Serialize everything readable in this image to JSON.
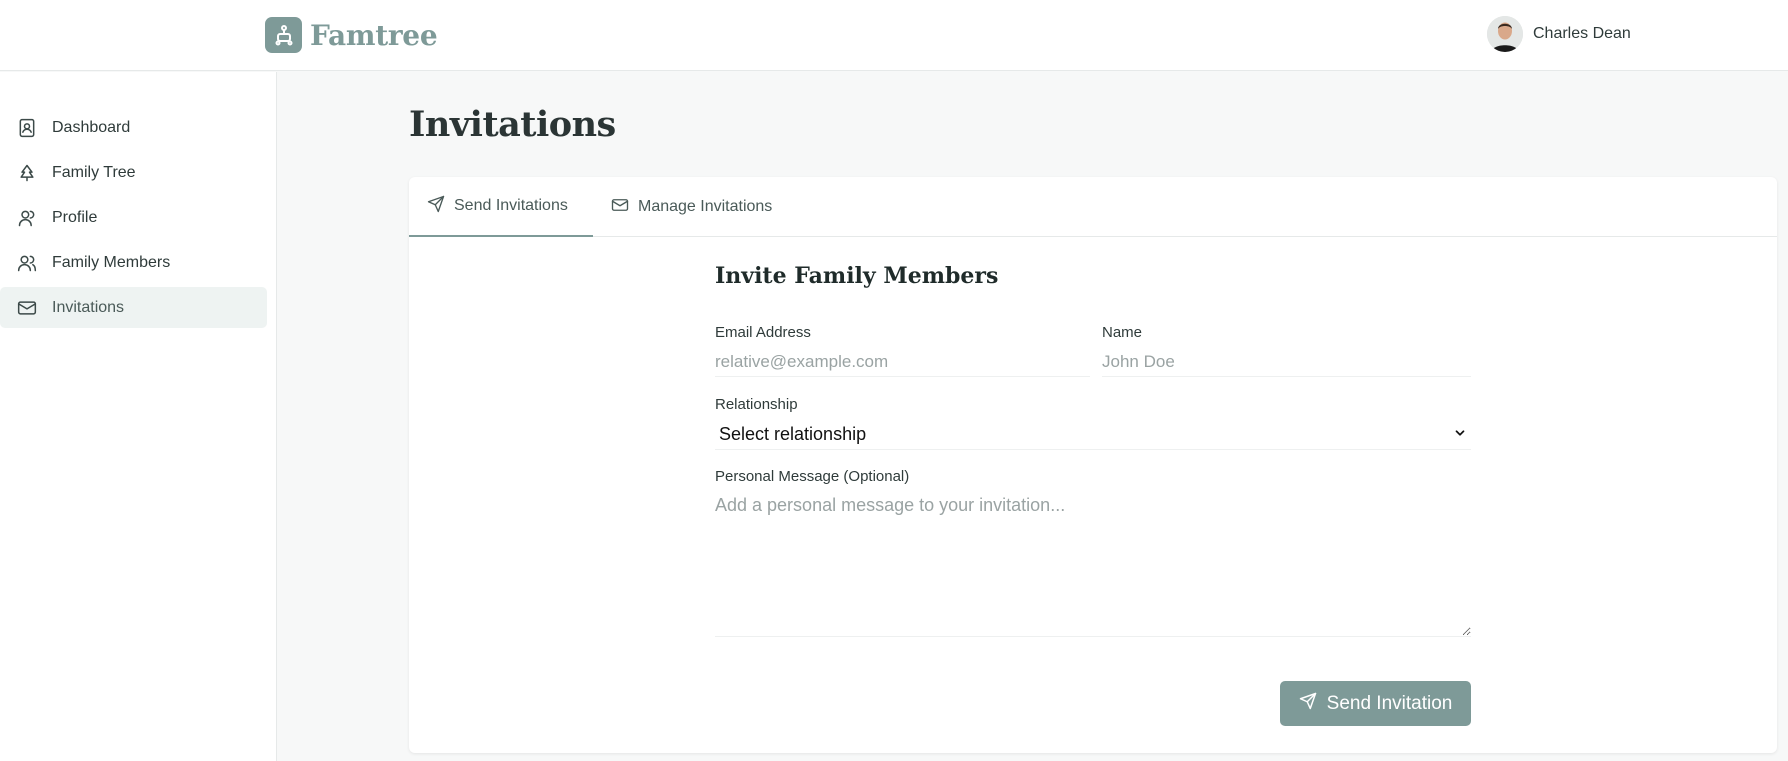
{
  "app": {
    "name": "Famtree",
    "accent": "#7e9a98"
  },
  "user": {
    "name": "Charles Dean"
  },
  "sidebar": {
    "items": [
      {
        "label": "Dashboard",
        "icon": "contact-book-icon"
      },
      {
        "label": "Family Tree",
        "icon": "tree-icon"
      },
      {
        "label": "Profile",
        "icon": "user-icon"
      },
      {
        "label": "Family Members",
        "icon": "users-icon"
      },
      {
        "label": "Invitations",
        "icon": "mail-icon",
        "active": true
      }
    ]
  },
  "page": {
    "title": "Invitations"
  },
  "tabs": [
    {
      "label": "Send Invitations",
      "icon": "send-icon",
      "active": true
    },
    {
      "label": "Manage Invitations",
      "icon": "mail-icon"
    }
  ],
  "form": {
    "title": "Invite Family Members",
    "email": {
      "label": "Email Address",
      "placeholder": "relative@example.com",
      "value": ""
    },
    "name": {
      "label": "Name",
      "placeholder": "John Doe",
      "value": ""
    },
    "relationship": {
      "label": "Relationship",
      "selected": "Select relationship"
    },
    "message": {
      "label": "Personal Message (Optional)",
      "placeholder": "Add a personal message to your invitation..."
    },
    "submit_label": "Send Invitation"
  }
}
